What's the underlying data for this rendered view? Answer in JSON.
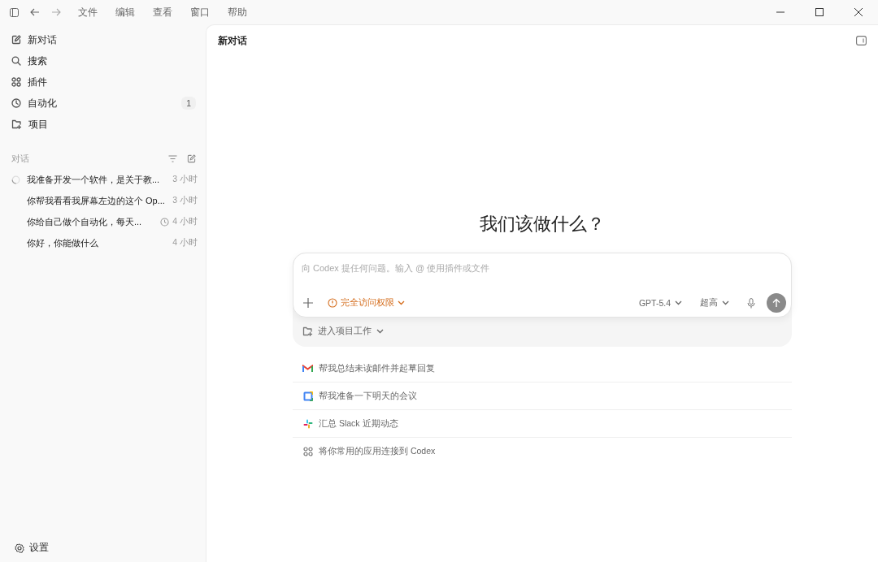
{
  "titlebar": {
    "menus": [
      "文件",
      "编辑",
      "查看",
      "窗口",
      "帮助"
    ]
  },
  "sidebar": {
    "nav": [
      {
        "kind": "new",
        "label": "新对话"
      },
      {
        "kind": "search",
        "label": "搜索"
      },
      {
        "kind": "plugins",
        "label": "插件"
      },
      {
        "kind": "automation",
        "label": "自动化",
        "badge": "1"
      },
      {
        "kind": "projects",
        "label": "项目"
      }
    ],
    "section_title": "对话",
    "threads": [
      {
        "kind": "running",
        "title": "我准备开发一个软件，是关于教...",
        "time": "3 小时"
      },
      {
        "kind": "plain",
        "title": "你帮我看看我屏幕左边的这个 Op...",
        "time": "3 小时"
      },
      {
        "kind": "scheduled",
        "title": "你给自己做个自动化，每天...",
        "time": "4 小时"
      },
      {
        "kind": "plain",
        "title": "你好，你能做什么",
        "time": "4 小时"
      }
    ],
    "settings": "设置"
  },
  "main": {
    "title": "新对话",
    "heading": "我们该做什么？",
    "composer": {
      "placeholder": "向 Codex 提任何问题。输入 @ 使用插件或文件",
      "access": "完全访问权限",
      "model": "GPT-5.4",
      "effort": "超高"
    },
    "project_button": "进入项目工作",
    "suggestions": [
      {
        "kind": "mail",
        "text": "帮我总结未读邮件并起草回复"
      },
      {
        "kind": "calendar",
        "text": "帮我准备一下明天的会议"
      },
      {
        "kind": "chat",
        "text": "汇总 Slack 近期动态"
      },
      {
        "kind": "apps",
        "text": "将你常用的应用连接到 Codex"
      }
    ]
  }
}
